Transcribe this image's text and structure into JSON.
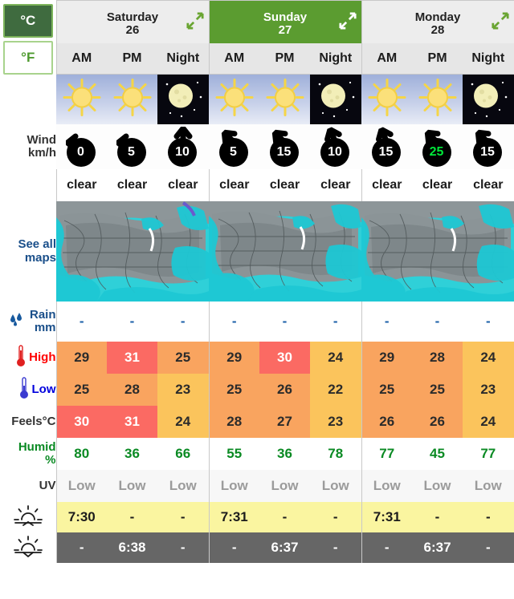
{
  "units": {
    "celsius_label": "°C",
    "fahrenheit_label": "°F",
    "active": "°C"
  },
  "sidebar": {
    "see_all_maps_line1": "See all",
    "see_all_maps_line2": "maps",
    "rain_line1": "Rain",
    "rain_line2": "mm",
    "high_label": "High",
    "low_label": "Low",
    "feels_label": "Feels°C",
    "humid_line1": "Humid",
    "humid_line2": "%",
    "uv_label": "UV",
    "wind_line1": "Wind",
    "wind_line2": "km/h"
  },
  "days": [
    {
      "name": "Saturday",
      "date": "26",
      "selected": false
    },
    {
      "name": "Sunday",
      "date": "27",
      "selected": true
    },
    {
      "name": "Monday",
      "date": "28",
      "selected": false
    }
  ],
  "periods": [
    "AM",
    "PM",
    "Night",
    "AM",
    "PM",
    "Night",
    "AM",
    "PM",
    "Night"
  ],
  "sky": [
    {
      "icon": "sun-icon",
      "night": false
    },
    {
      "icon": "sun-icon",
      "night": false
    },
    {
      "icon": "moon-icon",
      "night": true
    },
    {
      "icon": "sun-icon",
      "night": false
    },
    {
      "icon": "sun-icon",
      "night": false
    },
    {
      "icon": "moon-icon",
      "night": true
    },
    {
      "icon": "sun-icon",
      "night": false
    },
    {
      "icon": "sun-icon",
      "night": false
    },
    {
      "icon": "moon-icon",
      "night": true
    }
  ],
  "wind": {
    "values": [
      "0",
      "5",
      "10",
      "5",
      "15",
      "10",
      "15",
      "25",
      "15"
    ],
    "directions": [
      270,
      270,
      0,
      315,
      315,
      315,
      315,
      315,
      315
    ],
    "highlight": [
      false,
      false,
      false,
      false,
      false,
      false,
      false,
      true,
      false
    ]
  },
  "conditions": [
    "clear",
    "clear",
    "clear",
    "clear",
    "clear",
    "clear",
    "clear",
    "clear",
    "clear"
  ],
  "rain": [
    "-",
    "-",
    "-",
    "-",
    "-",
    "-",
    "-",
    "-",
    "-"
  ],
  "high": {
    "values": [
      "29",
      "31",
      "25",
      "29",
      "30",
      "24",
      "29",
      "28",
      "24"
    ],
    "colors": [
      "orange",
      "red",
      "orange",
      "orange",
      "red",
      "gold",
      "orange",
      "orange",
      "gold"
    ]
  },
  "low": {
    "values": [
      "25",
      "28",
      "23",
      "25",
      "26",
      "22",
      "25",
      "25",
      "23"
    ],
    "colors": [
      "orange",
      "orange",
      "gold",
      "orange",
      "orange",
      "gold",
      "orange",
      "orange",
      "gold"
    ]
  },
  "feels": {
    "values": [
      "30",
      "31",
      "24",
      "28",
      "27",
      "23",
      "26",
      "26",
      "24"
    ],
    "colors": [
      "red",
      "red",
      "gold",
      "orange",
      "orange",
      "gold",
      "orange",
      "orange",
      "gold"
    ]
  },
  "humidity": [
    "80",
    "36",
    "66",
    "55",
    "36",
    "78",
    "77",
    "45",
    "77"
  ],
  "uv": [
    "Low",
    "Low",
    "Low",
    "Low",
    "Low",
    "Low",
    "Low",
    "Low",
    "Low"
  ],
  "sunrise": [
    "7:30",
    "-",
    "-",
    "7:31",
    "-",
    "-",
    "7:31",
    "-",
    "-"
  ],
  "sunset": [
    "-",
    "6:38",
    "-",
    "-",
    "6:37",
    "-",
    "-",
    "6:37",
    "-"
  ],
  "colors": {
    "hot": "#fb6a63",
    "warm": "#f9a45f",
    "mild": "#fbc45c",
    "selected_day": "#5b9c30",
    "humid_text": "#0a8a23",
    "rain_text": "#1a5fa8",
    "sunrise_bg": "#faf5a0",
    "sunset_bg": "#666666",
    "wind_highlight": "#00e83a"
  },
  "icons": {
    "expand": "expand-arrows-icon",
    "sunrise": "sunrise-icon",
    "sunset": "sunset-icon",
    "rain_drops": "rain-drops-icon",
    "thermometer_high": "thermometer-red-icon",
    "thermometer_low": "thermometer-blue-icon"
  }
}
